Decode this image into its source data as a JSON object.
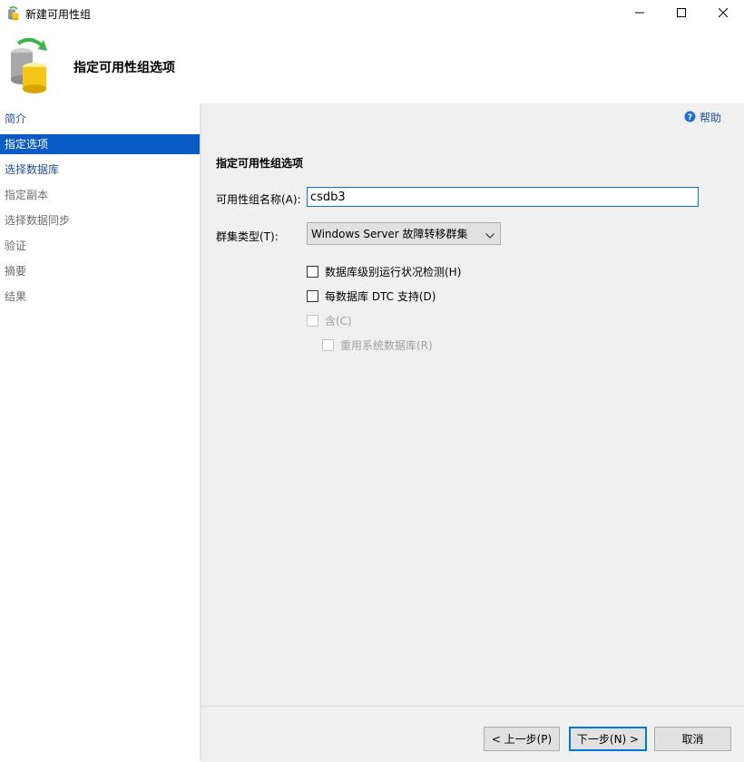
{
  "window": {
    "title": "新建可用性组",
    "minimize_icon": "minimize-icon",
    "maximize_icon": "maximize-icon",
    "close_icon": "close-icon"
  },
  "header": {
    "title": "指定可用性组选项",
    "icon": "database-cluster-icon"
  },
  "sidebar": {
    "items": [
      {
        "label": "简介",
        "state": "link"
      },
      {
        "label": "指定选项",
        "state": "selected"
      },
      {
        "label": "选择数据库",
        "state": "link"
      },
      {
        "label": "指定副本",
        "state": "disabled"
      },
      {
        "label": "选择数据同步",
        "state": "disabled"
      },
      {
        "label": "验证",
        "state": "disabled"
      },
      {
        "label": "摘要",
        "state": "disabled"
      },
      {
        "label": "结果",
        "state": "disabled"
      }
    ]
  },
  "main": {
    "help_label": "帮助",
    "section_title": "指定可用性组选项",
    "name_label": "可用性组名称(A):",
    "name_value": "csdb3",
    "cluster_type_label": "群集类型(T):",
    "cluster_type_value": "Windows Server 故障转移群集",
    "checkboxes": [
      {
        "label": "数据库级别运行状况检测(H)",
        "checked": false,
        "enabled": true
      },
      {
        "label": "每数据库 DTC 支持(D)",
        "checked": false,
        "enabled": true
      },
      {
        "label": "含(C)",
        "checked": false,
        "enabled": false
      },
      {
        "label": "重用系统数据库(R)",
        "checked": false,
        "enabled": false
      }
    ]
  },
  "footer": {
    "prev_label": "< 上一步(P)",
    "next_label": "下一步(N) >",
    "cancel_label": "取消"
  },
  "colors": {
    "accent": "#0078d7",
    "nav_selected": "#0a5bc4",
    "link": "#1f4f9f",
    "panel_bg": "#f0f0f0"
  }
}
